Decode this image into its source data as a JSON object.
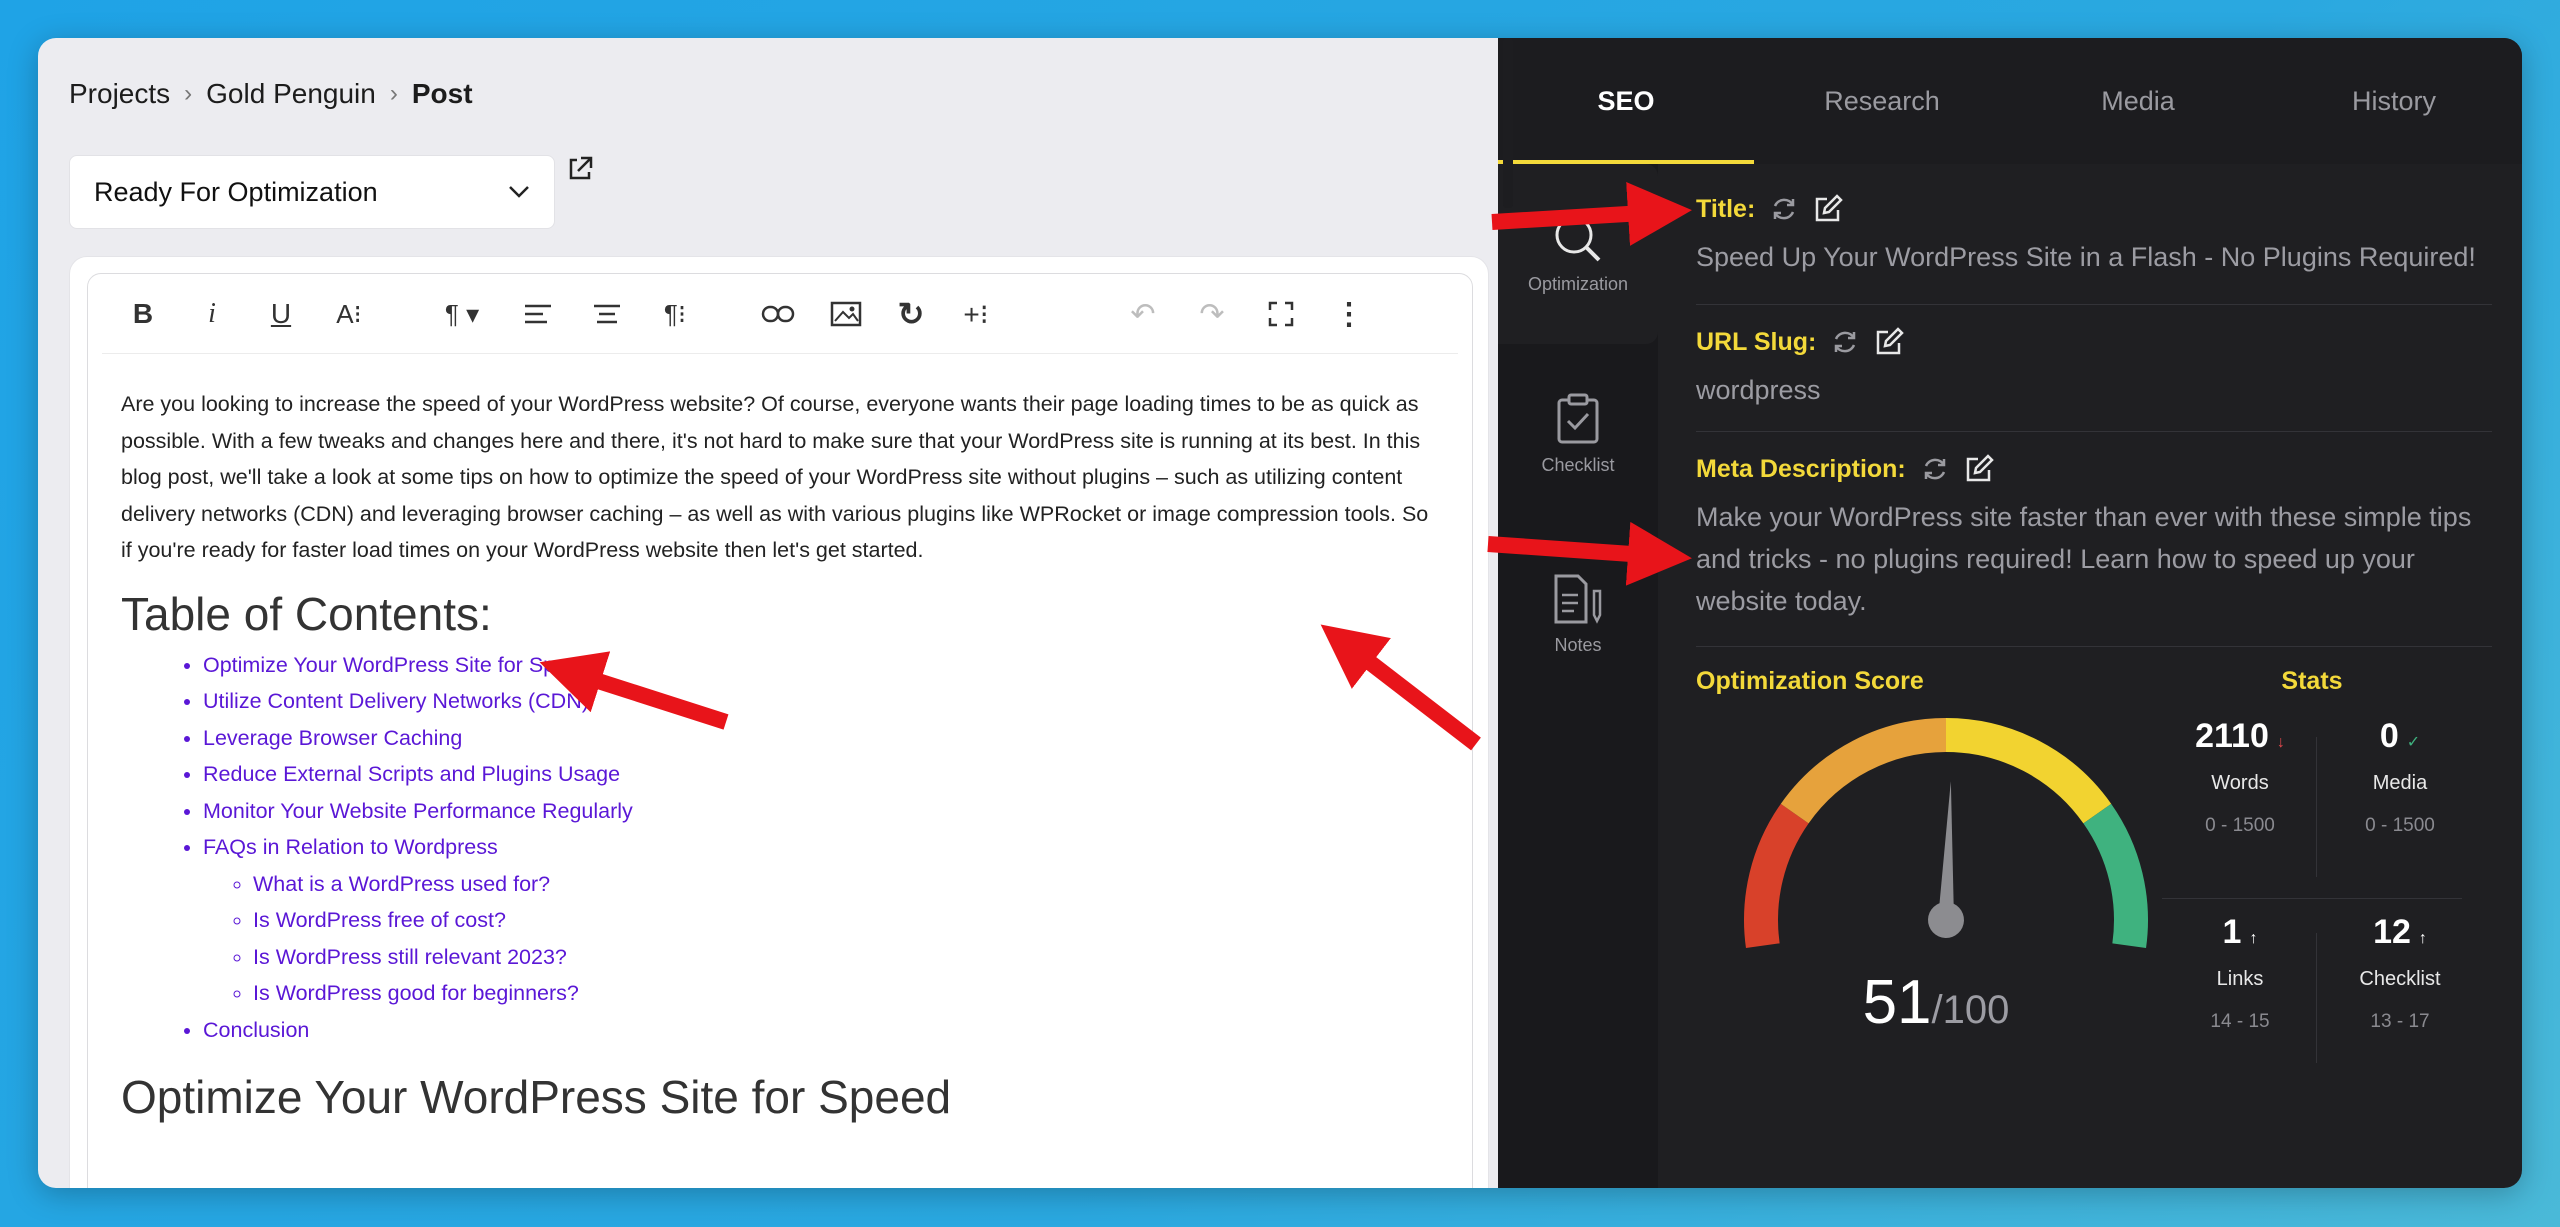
{
  "breadcrumb": {
    "projects": "Projects",
    "project": "Gold Penguin",
    "current": "Post"
  },
  "status_select": {
    "value": "Ready For Optimization"
  },
  "editor": {
    "intro": "Are you looking to increase the speed of your WordPress website? Of course, everyone wants their page loading times to be as quick as possible. With a few tweaks and changes here and there, it's not hard to make sure that your WordPress site is running at its best. In this blog post, we'll take a look at some tips on how to optimize the speed of your WordPress site without plugins – such as utilizing content delivery networks (CDN) and leveraging browser caching – as well as with various plugins like WPRocket or image compression tools. So if you're ready for faster load times on your WordPress website then let's get started.",
    "toc_heading": "Table of Contents:",
    "toc": [
      "Optimize Your WordPress Site for Speed",
      "Utilize Content Delivery Networks (CDN)",
      "Leverage Browser Caching",
      "Reduce External Scripts and Plugins Usage",
      "Monitor Your Website Performance Regularly",
      "FAQs in Relation to Wordpress"
    ],
    "toc_sub": [
      "What is a WordPress used for?",
      "Is WordPress free of cost?",
      "Is WordPress still relevant 2023?",
      "Is WordPress good for beginners?"
    ],
    "toc_last": "Conclusion",
    "next_heading": "Optimize Your WordPress Site for Speed"
  },
  "tabs": [
    "SEO",
    "Research",
    "Media",
    "History"
  ],
  "rail": [
    "Optimization",
    "Checklist",
    "Notes"
  ],
  "seo": {
    "title_label": "Title:",
    "title_value": "Speed Up Your WordPress Site in a Flash - No Plugins Required!",
    "slug_label": "URL Slug:",
    "slug_value": "wordpress",
    "meta_label": "Meta Description:",
    "meta_value": "Make your WordPress site faster than ever with these simple tips and tricks - no plugins required! Learn how to speed up your website today."
  },
  "score": {
    "label": "Optimization Score",
    "value": "51",
    "max": "/100",
    "fraction": 0.51
  },
  "stats": {
    "label": "Stats",
    "items": [
      {
        "num": "2110",
        "trend": "↓",
        "label": "Words",
        "range": "0 - 1500",
        "trend_color": "#e5484d"
      },
      {
        "num": "0",
        "trend": "✓",
        "label": "Media",
        "range": "0 - 1500",
        "trend_color": "#3fb27f"
      },
      {
        "num": "1",
        "trend": "↑",
        "label": "Links",
        "range": "14 - 15",
        "trend_color": "#ffffff"
      },
      {
        "num": "12",
        "trend": "↑",
        "label": "Checklist",
        "range": "13 - 17",
        "trend_color": "#ffffff"
      }
    ]
  },
  "colors": {
    "accent": "#f3d93a",
    "link": "#5a17d6",
    "arrow": "#e8141a"
  }
}
